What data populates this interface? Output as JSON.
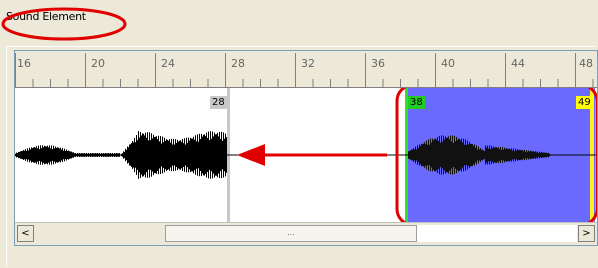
{
  "panel": {
    "title": "Sound Element"
  },
  "ruler": {
    "labels": [
      "16",
      "20",
      "24",
      "28",
      "32",
      "36",
      "40",
      "44",
      "48"
    ]
  },
  "markers": {
    "left_end": "28",
    "sel_start": "38",
    "sel_end": "49"
  },
  "scroll": {
    "left": "<",
    "right": ">",
    "thumb": "..."
  },
  "colors": {
    "selection": "#6a6aff",
    "annotation": "#e00000",
    "start_bar": "#33dd33",
    "end_bar": "#ffee22"
  }
}
